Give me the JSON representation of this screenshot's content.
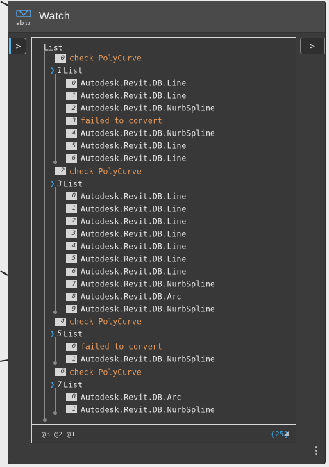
{
  "node": {
    "title": "Watch",
    "input_port_label": ">",
    "output_port_label": ">"
  },
  "tree": {
    "root_label": "List",
    "rows": [
      {
        "depth": 1,
        "type": "item",
        "index": "0",
        "value": "check PolyCurve",
        "warn": true
      },
      {
        "depth": 1,
        "type": "list",
        "index": "1",
        "value": "List"
      },
      {
        "depth": 2,
        "type": "item",
        "index": "0",
        "value": "Autodesk.Revit.DB.Line"
      },
      {
        "depth": 2,
        "type": "item",
        "index": "1",
        "value": "Autodesk.Revit.DB.Line"
      },
      {
        "depth": 2,
        "type": "item",
        "index": "2",
        "value": "Autodesk.Revit.DB.NurbSpline"
      },
      {
        "depth": 2,
        "type": "item",
        "index": "3",
        "value": "failed to convert",
        "warn": true
      },
      {
        "depth": 2,
        "type": "item",
        "index": "4",
        "value": "Autodesk.Revit.DB.NurbSpline"
      },
      {
        "depth": 2,
        "type": "item",
        "index": "5",
        "value": "Autodesk.Revit.DB.Line"
      },
      {
        "depth": 2,
        "type": "item",
        "index": "6",
        "value": "Autodesk.Revit.DB.Line"
      },
      {
        "depth": 1,
        "type": "item",
        "index": "2",
        "value": "check PolyCurve",
        "warn": true
      },
      {
        "depth": 1,
        "type": "list",
        "index": "3",
        "value": "List"
      },
      {
        "depth": 2,
        "type": "item",
        "index": "0",
        "value": "Autodesk.Revit.DB.Line"
      },
      {
        "depth": 2,
        "type": "item",
        "index": "1",
        "value": "Autodesk.Revit.DB.Line"
      },
      {
        "depth": 2,
        "type": "item",
        "index": "2",
        "value": "Autodesk.Revit.DB.Line"
      },
      {
        "depth": 2,
        "type": "item",
        "index": "3",
        "value": "Autodesk.Revit.DB.Line"
      },
      {
        "depth": 2,
        "type": "item",
        "index": "4",
        "value": "Autodesk.Revit.DB.Line"
      },
      {
        "depth": 2,
        "type": "item",
        "index": "5",
        "value": "Autodesk.Revit.DB.Line"
      },
      {
        "depth": 2,
        "type": "item",
        "index": "6",
        "value": "Autodesk.Revit.DB.Line"
      },
      {
        "depth": 2,
        "type": "item",
        "index": "7",
        "value": "Autodesk.Revit.DB.NurbSpline"
      },
      {
        "depth": 2,
        "type": "item",
        "index": "8",
        "value": "Autodesk.Revit.DB.Arc"
      },
      {
        "depth": 2,
        "type": "item",
        "index": "9",
        "value": "Autodesk.Revit.DB.NurbSpline"
      },
      {
        "depth": 1,
        "type": "item",
        "index": "4",
        "value": "check PolyCurve",
        "warn": true
      },
      {
        "depth": 1,
        "type": "list",
        "index": "5",
        "value": "List"
      },
      {
        "depth": 2,
        "type": "item",
        "index": "0",
        "value": "failed to convert",
        "warn": true
      },
      {
        "depth": 2,
        "type": "item",
        "index": "1",
        "value": "Autodesk.Revit.DB.NurbSpline"
      },
      {
        "depth": 1,
        "type": "item",
        "index": "6",
        "value": "check PolyCurve",
        "warn": true
      },
      {
        "depth": 1,
        "type": "list",
        "index": "7",
        "value": "List"
      },
      {
        "depth": 2,
        "type": "item",
        "index": "0",
        "value": "Autodesk.Revit.DB.Arc"
      },
      {
        "depth": 2,
        "type": "item",
        "index": "1",
        "value": "Autodesk.Revit.DB.NurbSpline"
      }
    ]
  },
  "footer": {
    "levels": "@3 @2 @1",
    "count": "{25}"
  },
  "colors": {
    "warn": "#e89b5a",
    "accent": "#3aa0e0"
  },
  "icons": {
    "node_icon": "watch-ab12-icon",
    "expand": "chevron-right-icon"
  }
}
